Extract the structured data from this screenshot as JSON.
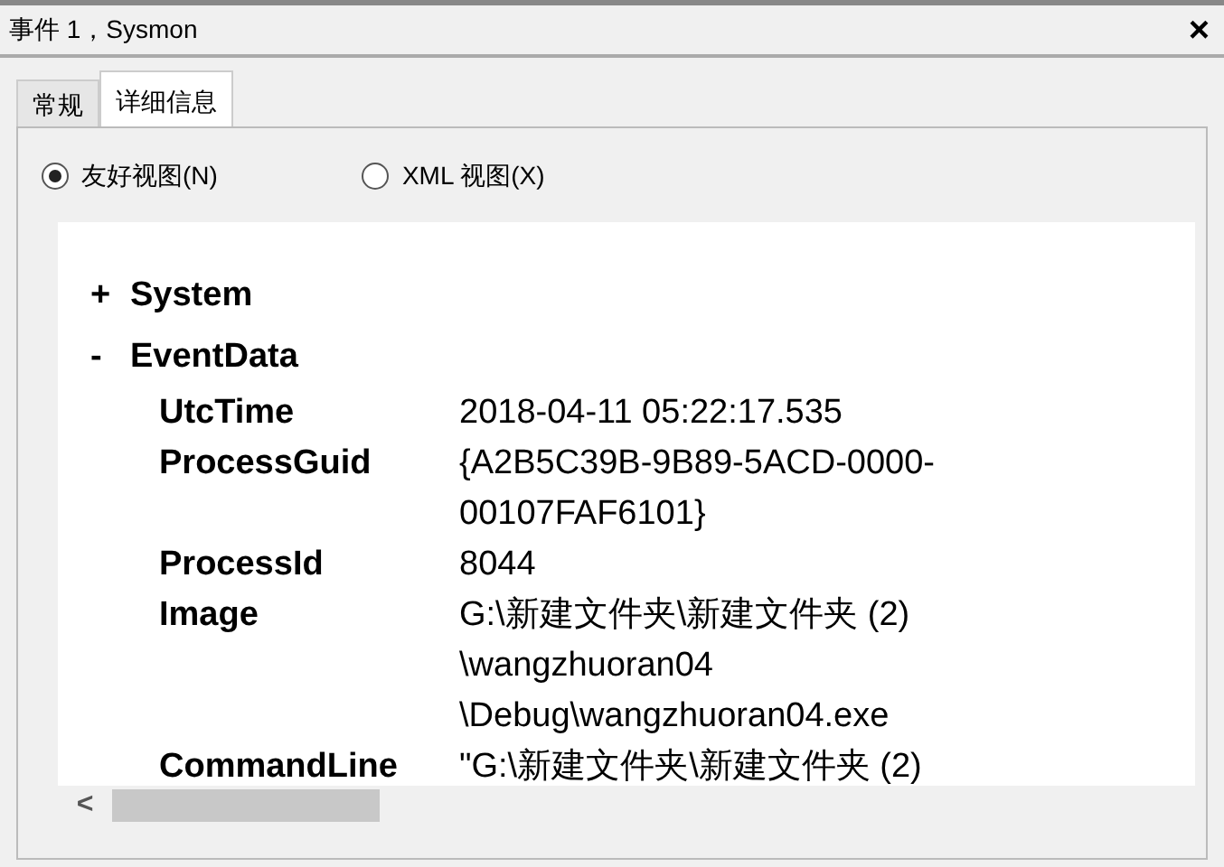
{
  "window": {
    "title": "事件 1，Sysmon",
    "close": "×"
  },
  "tabs": [
    {
      "label": "常规",
      "selected": false
    },
    {
      "label": "详细信息",
      "selected": true
    }
  ],
  "view_options": [
    {
      "label": "友好视图(N)",
      "selected": true
    },
    {
      "label": "XML 视图(X)",
      "selected": false
    }
  ],
  "tree": [
    {
      "toggle": "+",
      "label": "System"
    },
    {
      "toggle": "-",
      "label": "EventData",
      "fields": [
        {
          "name": "UtcTime",
          "lines": [
            "2018-04-11 05:22:17.535"
          ]
        },
        {
          "name": "ProcessGuid",
          "lines": [
            "{A2B5C39B-9B89-5ACD-0000-",
            "00107FAF6101}"
          ]
        },
        {
          "name": "ProcessId",
          "lines": [
            "8044"
          ]
        },
        {
          "name": "Image",
          "lines": [
            "G:\\新建文件夹\\新建文件夹 (2)",
            "\\wangzhuoran04",
            "\\Debug\\wangzhuoran04.exe"
          ]
        },
        {
          "name": "CommandLine",
          "lines": [
            "\"G:\\新建文件夹\\新建文件夹 (2)"
          ]
        }
      ]
    }
  ],
  "scrollbar": {
    "left_arrow": "<"
  }
}
